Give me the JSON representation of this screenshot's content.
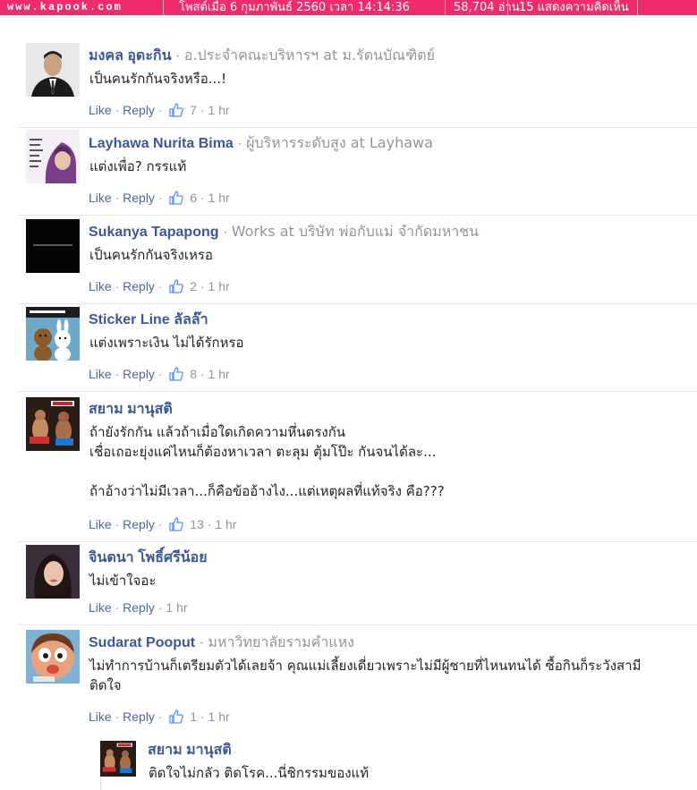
{
  "topbar": {
    "site": "www.kapook.com",
    "posted": "โพสต์เมื่อ 6 กุมภาพันธ์ 2560 เวลา 14:14:36",
    "views": "58,704 อ่าน",
    "comments": "15 แสดงความคิดเห็น"
  },
  "labels": {
    "like": "Like",
    "reply": "Reply",
    "dot": "·"
  },
  "comments": [
    {
      "name": "มงคล อุดะกิน",
      "subtitle": "อ.ประจำคณะบริหารฯ at ม.รัตนบัณฑิตย์",
      "text": "เป็นคนรักกันจริงหรือ...!",
      "likes": "7",
      "time": "1 hr"
    },
    {
      "name": "Layhawa Nurita Bima",
      "subtitle": "ผู้บริหารระดับสูง at Layhawa",
      "text": "แต่งเพื่อ? กรรแท้",
      "likes": "6",
      "time": "1 hr"
    },
    {
      "name": "Sukanya Tapapong",
      "subtitle": "Works at บริษัท พ่อกับแม่ จำกัดมหาชน",
      "text": "เป็นคนรักกันจริงเหรอ",
      "likes": "2",
      "time": "1 hr"
    },
    {
      "name": "Sticker Line ลัลล๊า",
      "subtitle": "",
      "text": "แต่งเพราะเงิน ไม่ได้รักหรอ",
      "likes": "8",
      "time": "1 hr"
    },
    {
      "name": "สยาม มานุสติ",
      "subtitle": "",
      "text": "ถ้ายังรักกัน แล้วถ้าเมื่อใดเกิดความหึ่นตรงกัน\nเชื่อเถอะยุ่งแค่ไหนก็ต้องหาเวลา ตะลุม ตุ้มโป๊ะ กันจนได้ละ...\n\nถ้าอ้างว่าไม่มีเวลา...ก็คือข้ออ้างไง...แต่เหตุผลที่แท้จริง คือ???",
      "likes": "13",
      "time": "1 hr"
    },
    {
      "name": "จินตนา โพธิ์ศรีน้อย",
      "subtitle": "",
      "text": "ไม่เข้าใจอะ",
      "likes": "",
      "time": "1 hr"
    },
    {
      "name": "Sudarat Pooput",
      "subtitle": "มหาวิทยาลัยรามคำแหง",
      "text": "ไม่ทำการบ้านก็เตรียมตัวได้เลยจ้า คุณแม่เลี้ยงเดี่ยวเพราะไม่มีผู้ชายที่ไหนทนได้ ซื้อกินก็ระวังสามี\nติดใจ",
      "likes": "1",
      "time": "1 hr"
    }
  ],
  "reply": {
    "name": "สยาม มานุสติ",
    "text": "ติดใจไม่กลัว ติดโรค...นี่ชิกรรมของแท้"
  },
  "colors": {
    "topbar": "#ee2b6d",
    "link": "#3b5998",
    "action": "#4b67a1",
    "muted": "#90949c"
  }
}
